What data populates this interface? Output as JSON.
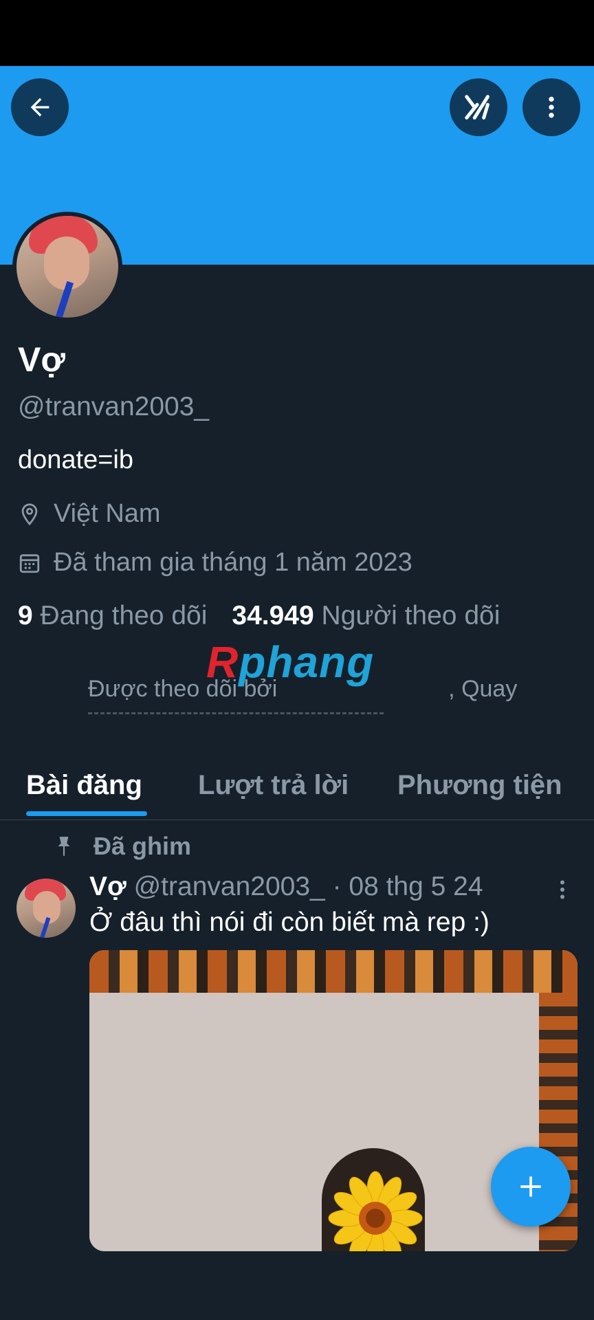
{
  "profile": {
    "name": "Vợ",
    "handle": "@tranvan2003_",
    "bio": "donate=ib",
    "location": "Việt Nam",
    "joined": "Đã tham gia tháng 1 năm 2023",
    "following_count": "9",
    "following_label": "Đang theo dõi",
    "followers_count": "34.949",
    "followers_label": "Người theo dõi",
    "followed_by": "Được theo dõi bởi",
    "followed_by_tail": ", Quay"
  },
  "watermark": {
    "r": "R",
    "rest": "phang"
  },
  "tabs": [
    {
      "label": "Bài đăng",
      "active": true
    },
    {
      "label": "Lượt trả lời",
      "active": false
    },
    {
      "label": "Phương tiện",
      "active": false
    }
  ],
  "pinned_label": "Đã ghim",
  "post": {
    "author": "Vợ",
    "handle_time": "@tranvan2003_ · 08 thg 5 24",
    "text": "Ở đâu thì nói đi còn biết mà rep :)"
  },
  "colors": {
    "accent": "#1d9bf0",
    "background": "#15202b",
    "muted": "#8b98a5"
  },
  "icons": [
    "back-arrow-icon",
    "grok-icon",
    "more-vertical-icon",
    "location-pin-icon",
    "calendar-icon",
    "pin-icon",
    "compose-plus-icon"
  ]
}
